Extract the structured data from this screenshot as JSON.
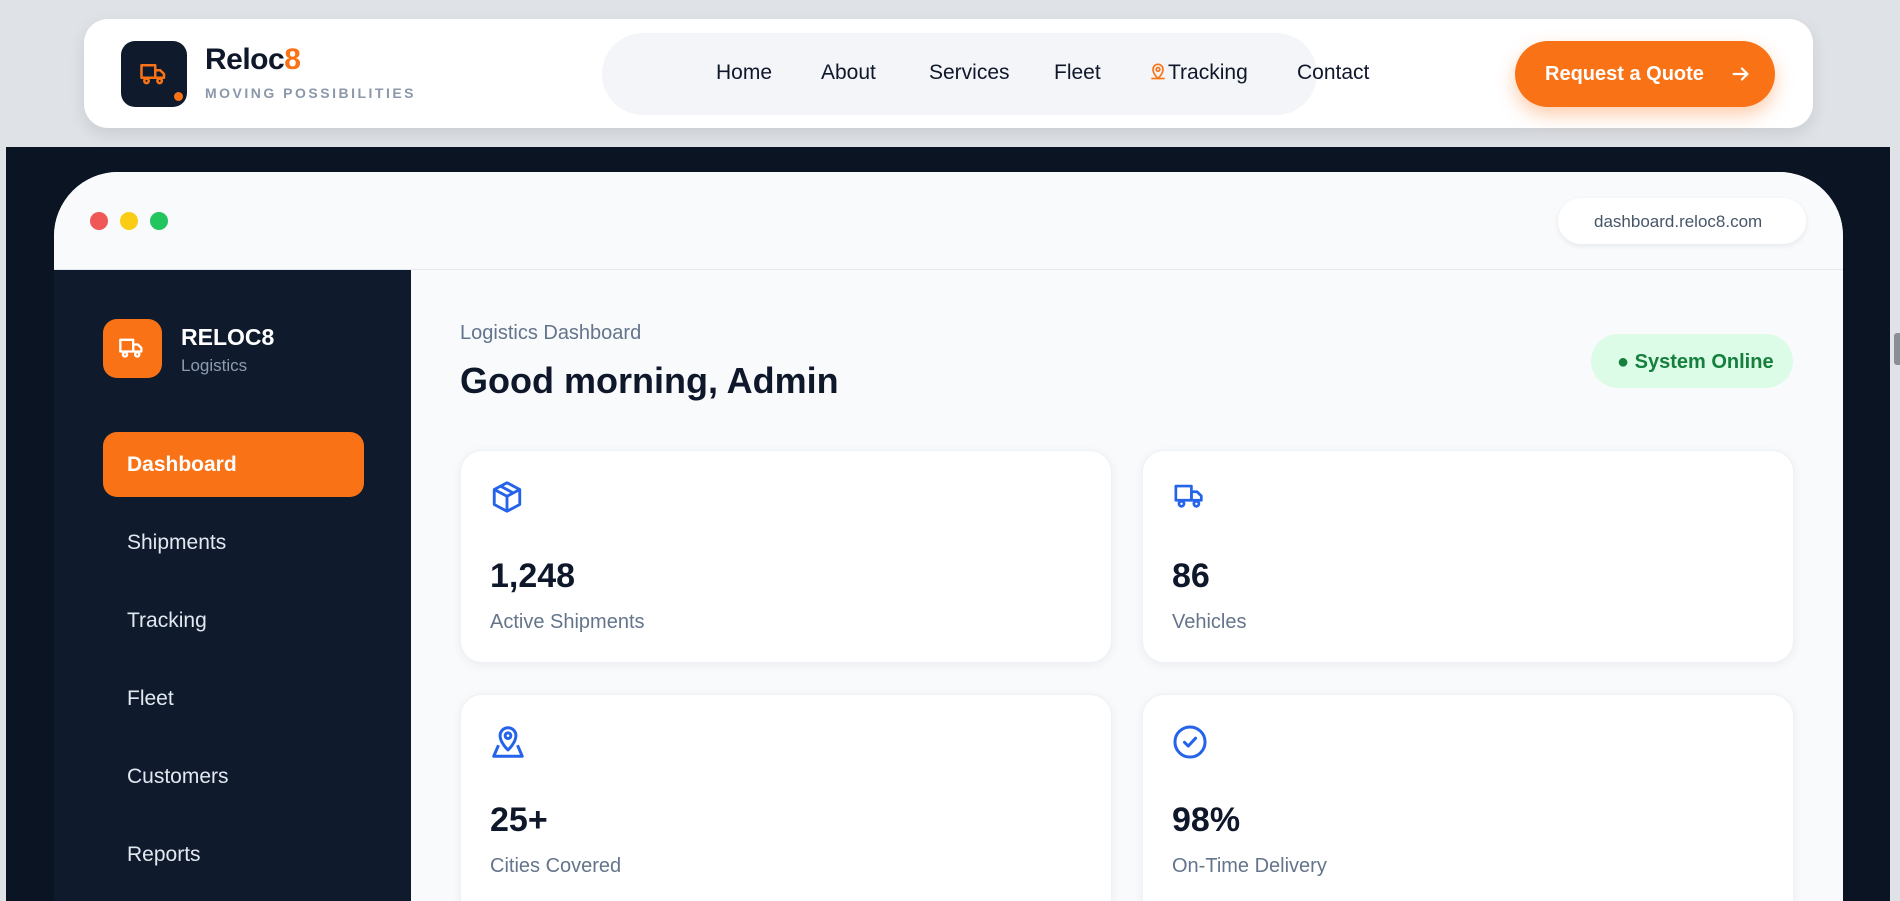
{
  "header": {
    "brand_main": "Reloc",
    "brand_accent": "8",
    "tagline": "MOVING POSSIBILITIES",
    "nav": [
      {
        "label": "Home"
      },
      {
        "label": "About"
      },
      {
        "label": "Services"
      },
      {
        "label": "Fleet"
      },
      {
        "label": "Tracking",
        "icon": "map-pin-icon"
      },
      {
        "label": "Contact"
      }
    ],
    "cta_label": "Request a Quote",
    "accent_color": "#f97316"
  },
  "browser": {
    "url": "dashboard.reloc8.com"
  },
  "sidebar": {
    "title": "RELOC8",
    "subtitle": "Logistics",
    "items": [
      {
        "label": "Dashboard",
        "active": true
      },
      {
        "label": "Shipments"
      },
      {
        "label": "Tracking"
      },
      {
        "label": "Fleet"
      },
      {
        "label": "Customers"
      },
      {
        "label": "Reports"
      }
    ]
  },
  "main": {
    "breadcrumb": "Logistics Dashboard",
    "greeting": "Good morning, Admin",
    "status": "● System Online",
    "stats": [
      {
        "value": "1,248",
        "label": "Active Shipments",
        "icon": "package-icon"
      },
      {
        "value": "86",
        "label": "Vehicles",
        "icon": "truck-icon"
      },
      {
        "value": "25+",
        "label": "Cities Covered",
        "icon": "map-pin-icon"
      },
      {
        "value": "98%",
        "label": "On-Time Delivery",
        "icon": "check-circle-icon"
      }
    ]
  }
}
